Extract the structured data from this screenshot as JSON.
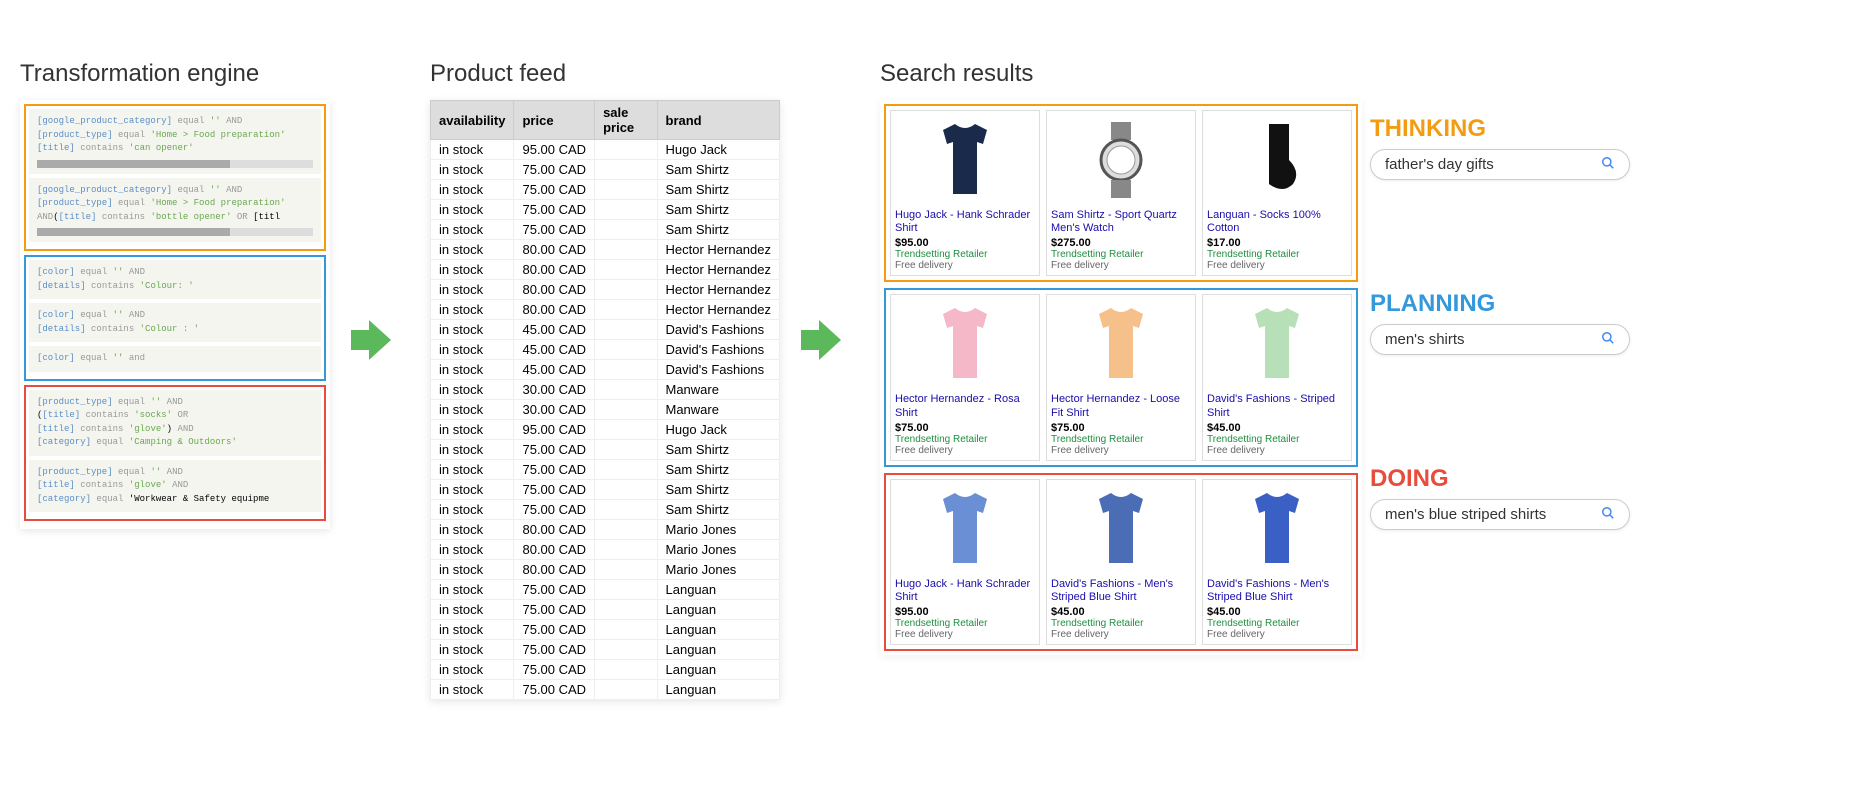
{
  "sections": {
    "transform": "Transformation engine",
    "feed": "Product feed",
    "results": "Search results"
  },
  "rules": {
    "orange": [
      "[google_product_category] equal '' AND\n[product_type] equal 'Home > Food preparation'\n[title] contains 'can opener'",
      "[google_product_category] equal '' AND\n[product_type] equal 'Home > Food preparation'\nAND([title] contains 'bottle opener' OR [titl"
    ],
    "blue": [
      "[color] equal '' AND\n[details] contains 'Colour: '",
      "[color] equal '' AND\n[details] contains 'Colour : '",
      "[color] equal '' and"
    ],
    "red": [
      "[product_type] equal '' AND\n([title] contains 'socks' OR\n[title] contains 'glove') AND\n[category] equal 'Camping & Outdoors'",
      "[product_type] equal '' AND\n[title] contains 'glove' AND\n[category] equal 'Workwear & Safety equipme"
    ]
  },
  "feed_headers": [
    "availability",
    "price",
    "sale price",
    "brand"
  ],
  "feed_rows": [
    [
      "in stock",
      "95.00 CAD",
      "",
      "Hugo Jack"
    ],
    [
      "in stock",
      "75.00 CAD",
      "",
      "Sam Shirtz"
    ],
    [
      "in stock",
      "75.00 CAD",
      "",
      "Sam Shirtz"
    ],
    [
      "in stock",
      "75.00 CAD",
      "",
      "Sam Shirtz"
    ],
    [
      "in stock",
      "75.00 CAD",
      "",
      "Sam Shirtz"
    ],
    [
      "in stock",
      "80.00 CAD",
      "",
      "Hector Hernandez"
    ],
    [
      "in stock",
      "80.00 CAD",
      "",
      "Hector Hernandez"
    ],
    [
      "in stock",
      "80.00 CAD",
      "",
      "Hector Hernandez"
    ],
    [
      "in stock",
      "80.00 CAD",
      "",
      "Hector Hernandez"
    ],
    [
      "in stock",
      "45.00 CAD",
      "",
      "David's Fashions"
    ],
    [
      "in stock",
      "45.00 CAD",
      "",
      "David's Fashions"
    ],
    [
      "in stock",
      "45.00 CAD",
      "",
      "David's Fashions"
    ],
    [
      "in stock",
      "30.00 CAD",
      "",
      "Manware"
    ],
    [
      "in stock",
      "30.00 CAD",
      "",
      "Manware"
    ],
    [
      "in stock",
      "95.00 CAD",
      "",
      "Hugo Jack"
    ],
    [
      "in stock",
      "75.00 CAD",
      "",
      "Sam Shirtz"
    ],
    [
      "in stock",
      "75.00 CAD",
      "",
      "Sam Shirtz"
    ],
    [
      "in stock",
      "75.00 CAD",
      "",
      "Sam Shirtz"
    ],
    [
      "in stock",
      "75.00 CAD",
      "",
      "Sam Shirtz"
    ],
    [
      "in stock",
      "80.00 CAD",
      "",
      "Mario Jones"
    ],
    [
      "in stock",
      "80.00 CAD",
      "",
      "Mario Jones"
    ],
    [
      "in stock",
      "80.00 CAD",
      "",
      "Mario Jones"
    ],
    [
      "in stock",
      "75.00 CAD",
      "",
      "Languan"
    ],
    [
      "in stock",
      "75.00 CAD",
      "",
      "Languan"
    ],
    [
      "in stock",
      "75.00 CAD",
      "",
      "Languan"
    ],
    [
      "in stock",
      "75.00 CAD",
      "",
      "Languan"
    ],
    [
      "in stock",
      "75.00 CAD",
      "",
      "Languan"
    ],
    [
      "in stock",
      "75.00 CAD",
      "",
      "Languan"
    ]
  ],
  "results": {
    "orange": [
      {
        "title": "Hugo Jack - Hank Schrader Shirt",
        "price": "$95.00",
        "retailer": "Trendsetting Retailer",
        "delivery": "Free delivery",
        "icon": "shirt-navy"
      },
      {
        "title": "Sam Shirtz -  Sport Quartz Men's Watch",
        "price": "$275.00",
        "retailer": "Trendsetting Retailer",
        "delivery": "Free delivery",
        "icon": "watch"
      },
      {
        "title": "Languan - Socks 100% Cotton",
        "price": "$17.00",
        "retailer": "Trendsetting Retailer",
        "delivery": "Free delivery",
        "icon": "sock"
      }
    ],
    "blue": [
      {
        "title": "Hector Hernandez - Rosa Shirt",
        "price": "$75.00",
        "retailer": "Trendsetting Retailer",
        "delivery": "Free delivery",
        "icon": "shirt-pink"
      },
      {
        "title": "Hector Hernandez - Loose Fit Shirt",
        "price": "$75.00",
        "retailer": "Trendsetting Retailer",
        "delivery": "Free delivery",
        "icon": "shirt-orange"
      },
      {
        "title": "David's Fashions - Striped Shirt",
        "price": "$45.00",
        "retailer": "Trendsetting Retailer",
        "delivery": "Free delivery",
        "icon": "shirt-green"
      }
    ],
    "red": [
      {
        "title": "Hugo Jack - Hank Schrader Shirt",
        "price": "$95.00",
        "retailer": "Trendsetting Retailer",
        "delivery": "Free delivery",
        "icon": "shirt-blue"
      },
      {
        "title": "David's Fashions - Men's Striped Blue Shirt",
        "price": "$45.00",
        "retailer": "Trendsetting Retailer",
        "delivery": "Free delivery",
        "icon": "shirt-blue2"
      },
      {
        "title": "David's Fashions - Men's Striped Blue Shirt",
        "price": "$45.00",
        "retailer": "Trendsetting Retailer",
        "delivery": "Free delivery",
        "icon": "shirt-stripe"
      }
    ]
  },
  "annotations": {
    "thinking": {
      "label": "THINKING",
      "query": "father's day gifts"
    },
    "planning": {
      "label": "PLANNING",
      "query": "men's shirts"
    },
    "doing": {
      "label": "DOING",
      "query": "men's blue striped shirts"
    }
  }
}
